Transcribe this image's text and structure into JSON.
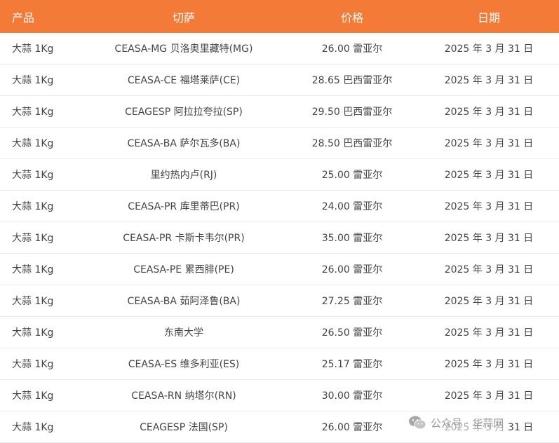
{
  "table": {
    "headers": {
      "product": "产品",
      "market": "切萨",
      "price": "价格",
      "date": "日期"
    },
    "rows": [
      {
        "product": "大蒜 1Kg",
        "market": "CEASA-MG 贝洛奥里藏特(MG)",
        "price": "26.00 雷亚尔",
        "date": "2025 年 3 月 31 日"
      },
      {
        "product": "大蒜 1Kg",
        "market": "CEASA-CE 福塔莱萨(CE)",
        "price": "28.65 巴西雷亚尔",
        "date": "2025 年 3 月 31 日"
      },
      {
        "product": "大蒜 1Kg",
        "market": "CEAGESP 阿拉拉夸拉(SP)",
        "price": "29.50 巴西雷亚尔",
        "date": "2025 年 3 月 31 日"
      },
      {
        "product": "大蒜 1Kg",
        "market": "CEASA-BA 萨尔瓦多(BA)",
        "price": "28.50 巴西雷亚尔",
        "date": "2025 年 3 月 31 日"
      },
      {
        "product": "大蒜 1Kg",
        "market": "里约热内卢(RJ)",
        "price": "25.00 雷亚尔",
        "date": "2025 年 3 月 31 日"
      },
      {
        "product": "大蒜 1Kg",
        "market": "CEASA-PR 库里蒂巴(PR)",
        "price": "24.00 雷亚尔",
        "date": "2025 年 3 月 31 日"
      },
      {
        "product": "大蒜 1Kg",
        "market": "CEASA-PR 卡斯卡韦尔(PR)",
        "price": "35.00 雷亚尔",
        "date": "2025 年 3 月 31 日"
      },
      {
        "product": "大蒜 1Kg",
        "market": "CEASA-PE 累西腓(PE)",
        "price": "26.00 雷亚尔",
        "date": "2025 年 3 月 31 日"
      },
      {
        "product": "大蒜 1Kg",
        "market": "CEASA-BA 茹阿泽鲁(BA)",
        "price": "27.25 雷亚尔",
        "date": "2025 年 3 月 31 日"
      },
      {
        "product": "大蒜 1Kg",
        "market": "东南大学",
        "price": "26.50 雷亚尔",
        "date": "2025 年 3 月 31 日"
      },
      {
        "product": "大蒜 1Kg",
        "market": "CEASA-ES 维多利亚(ES)",
        "price": "25.17 雷亚尔",
        "date": "2025 年 3 月 31 日"
      },
      {
        "product": "大蒜 1Kg",
        "market": "CEASA-RN 纳塔尔(RN)",
        "price": "30.00 雷亚尔",
        "date": "2025 年 3 月 31 日"
      },
      {
        "product": "大蒜 1Kg",
        "market": "CEAGESP 法国(SP)",
        "price": "26.00 雷亚尔",
        "date": "2025 年 3 月 31 日"
      }
    ]
  },
  "watermark": {
    "text": "公众号 · 华蒜网",
    "icon": "wechat-icon"
  },
  "colors": {
    "header_bg": "#f47a38",
    "header_text": "#ffffff",
    "row_text": "#444444",
    "row_border": "#eaeaea"
  }
}
